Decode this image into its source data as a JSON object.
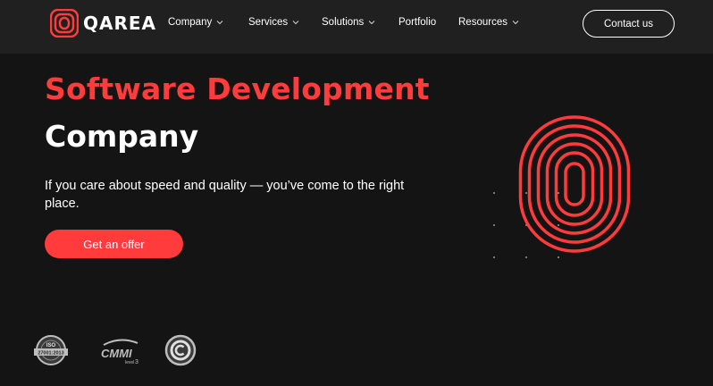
{
  "header": {
    "brand": "QAREA",
    "nav": [
      {
        "label": "Company",
        "has_dropdown": true
      },
      {
        "label": "Services",
        "has_dropdown": true
      },
      {
        "label": "Solutions",
        "has_dropdown": true
      },
      {
        "label": "Portfolio",
        "has_dropdown": false
      },
      {
        "label": "Resources",
        "has_dropdown": true
      }
    ],
    "contact_label": "Contact us"
  },
  "hero": {
    "title_line1": "Software Development",
    "title_line2": "Company",
    "subtitle": "If you care about speed and quality — you’ve come to the right place.",
    "cta_label": "Get an offer"
  },
  "badges": [
    {
      "name": "iso-badge",
      "texts": [
        "ISO",
        "27001:2013"
      ]
    },
    {
      "name": "cmmi-badge",
      "texts": [
        "CMMI",
        "level",
        "3"
      ]
    },
    {
      "name": "circle-c-badge",
      "texts": []
    }
  ],
  "colors": {
    "accent": "#ff3b3b",
    "background": "#141414",
    "header_bg": "#202020",
    "text": "#ffffff"
  }
}
